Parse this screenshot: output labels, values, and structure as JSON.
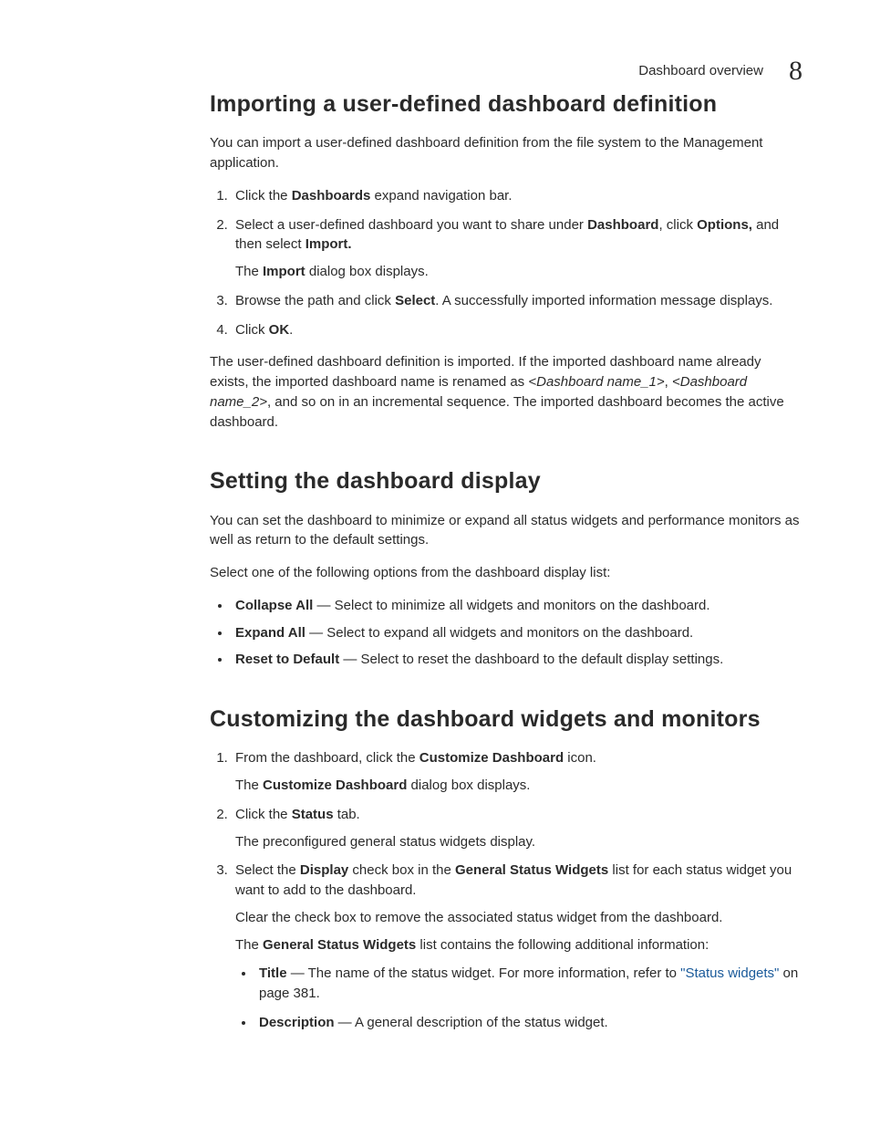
{
  "header": {
    "running_title": "Dashboard overview",
    "chapter_number": "8"
  },
  "sections": {
    "importing": {
      "title": "Importing a user-defined dashboard definition",
      "intro": "You can import a user-defined dashboard definition from the file system to the Management application.",
      "step1_a": "Click the ",
      "step1_b_bold": "Dashboards",
      "step1_c": " expand navigation bar.",
      "step2_a": "Select a user-defined dashboard you want to share under ",
      "step2_b_bold": "Dashboard",
      "step2_c": ", click ",
      "step2_d_bold": "Options,",
      "step2_e": " and then select ",
      "step2_f_bold": "Import.",
      "step2_sub_a": "The ",
      "step2_sub_b_bold": "Import",
      "step2_sub_c": " dialog box displays.",
      "step3_a": "Browse the path and click ",
      "step3_b_bold": "Select",
      "step3_c": ". A successfully imported information message displays.",
      "step4_a": "Click ",
      "step4_b_bold": "OK",
      "step4_c": ".",
      "outro_a": "The user-defined dashboard definition is imported. If the imported dashboard name already exists, the imported dashboard name is renamed as ",
      "outro_b_italic": "<Dashboard name_1>",
      "outro_c": ", ",
      "outro_d_italic": "<Dashboard name_2>",
      "outro_e": ", and so on in an incremental sequence. The imported dashboard becomes the active dashboard."
    },
    "setting": {
      "title": "Setting the dashboard display",
      "intro": "You can set the dashboard to minimize or expand all status widgets and performance monitors as well as return to the default settings.",
      "lead": "Select one of the following options from the dashboard display list:",
      "b1_bold": "Collapse All",
      "b1_rest": " — Select to minimize all widgets and monitors on the dashboard.",
      "b2_bold": "Expand All",
      "b2_rest": " — Select to expand all widgets and monitors on the dashboard.",
      "b3_bold": "Reset to Default",
      "b3_rest": " — Select to reset the dashboard to the default display settings."
    },
    "customizing": {
      "title": "Customizing the dashboard widgets and monitors",
      "step1_a": "From the dashboard, click the ",
      "step1_b_bold": "Customize Dashboard",
      "step1_c": " icon.",
      "step1_sub_a": "The ",
      "step1_sub_b_bold": "Customize Dashboard",
      "step1_sub_c": " dialog box displays.",
      "step2_a": "Click the ",
      "step2_b_bold": "Status",
      "step2_c": " tab.",
      "step2_sub": "The preconfigured general status widgets display.",
      "step3_a": "Select the ",
      "step3_b_bold": "Display",
      "step3_c": " check box in the ",
      "step3_d_bold": "General Status Widgets",
      "step3_e": " list for each status widget you want to add to the dashboard.",
      "step3_sub1": "Clear the check box to remove the associated status widget from the dashboard.",
      "step3_sub2_a": "The ",
      "step3_sub2_b_bold": "General Status Widgets",
      "step3_sub2_c": " list contains the following additional information:",
      "ib1_bold": "Title",
      "ib1_mid": " — The name of the status widget. For more information, refer to ",
      "ib1_link": "\"Status widgets\"",
      "ib1_end": " on page 381.",
      "ib2_bold": "Description",
      "ib2_rest": " — A general description of the status widget."
    }
  }
}
